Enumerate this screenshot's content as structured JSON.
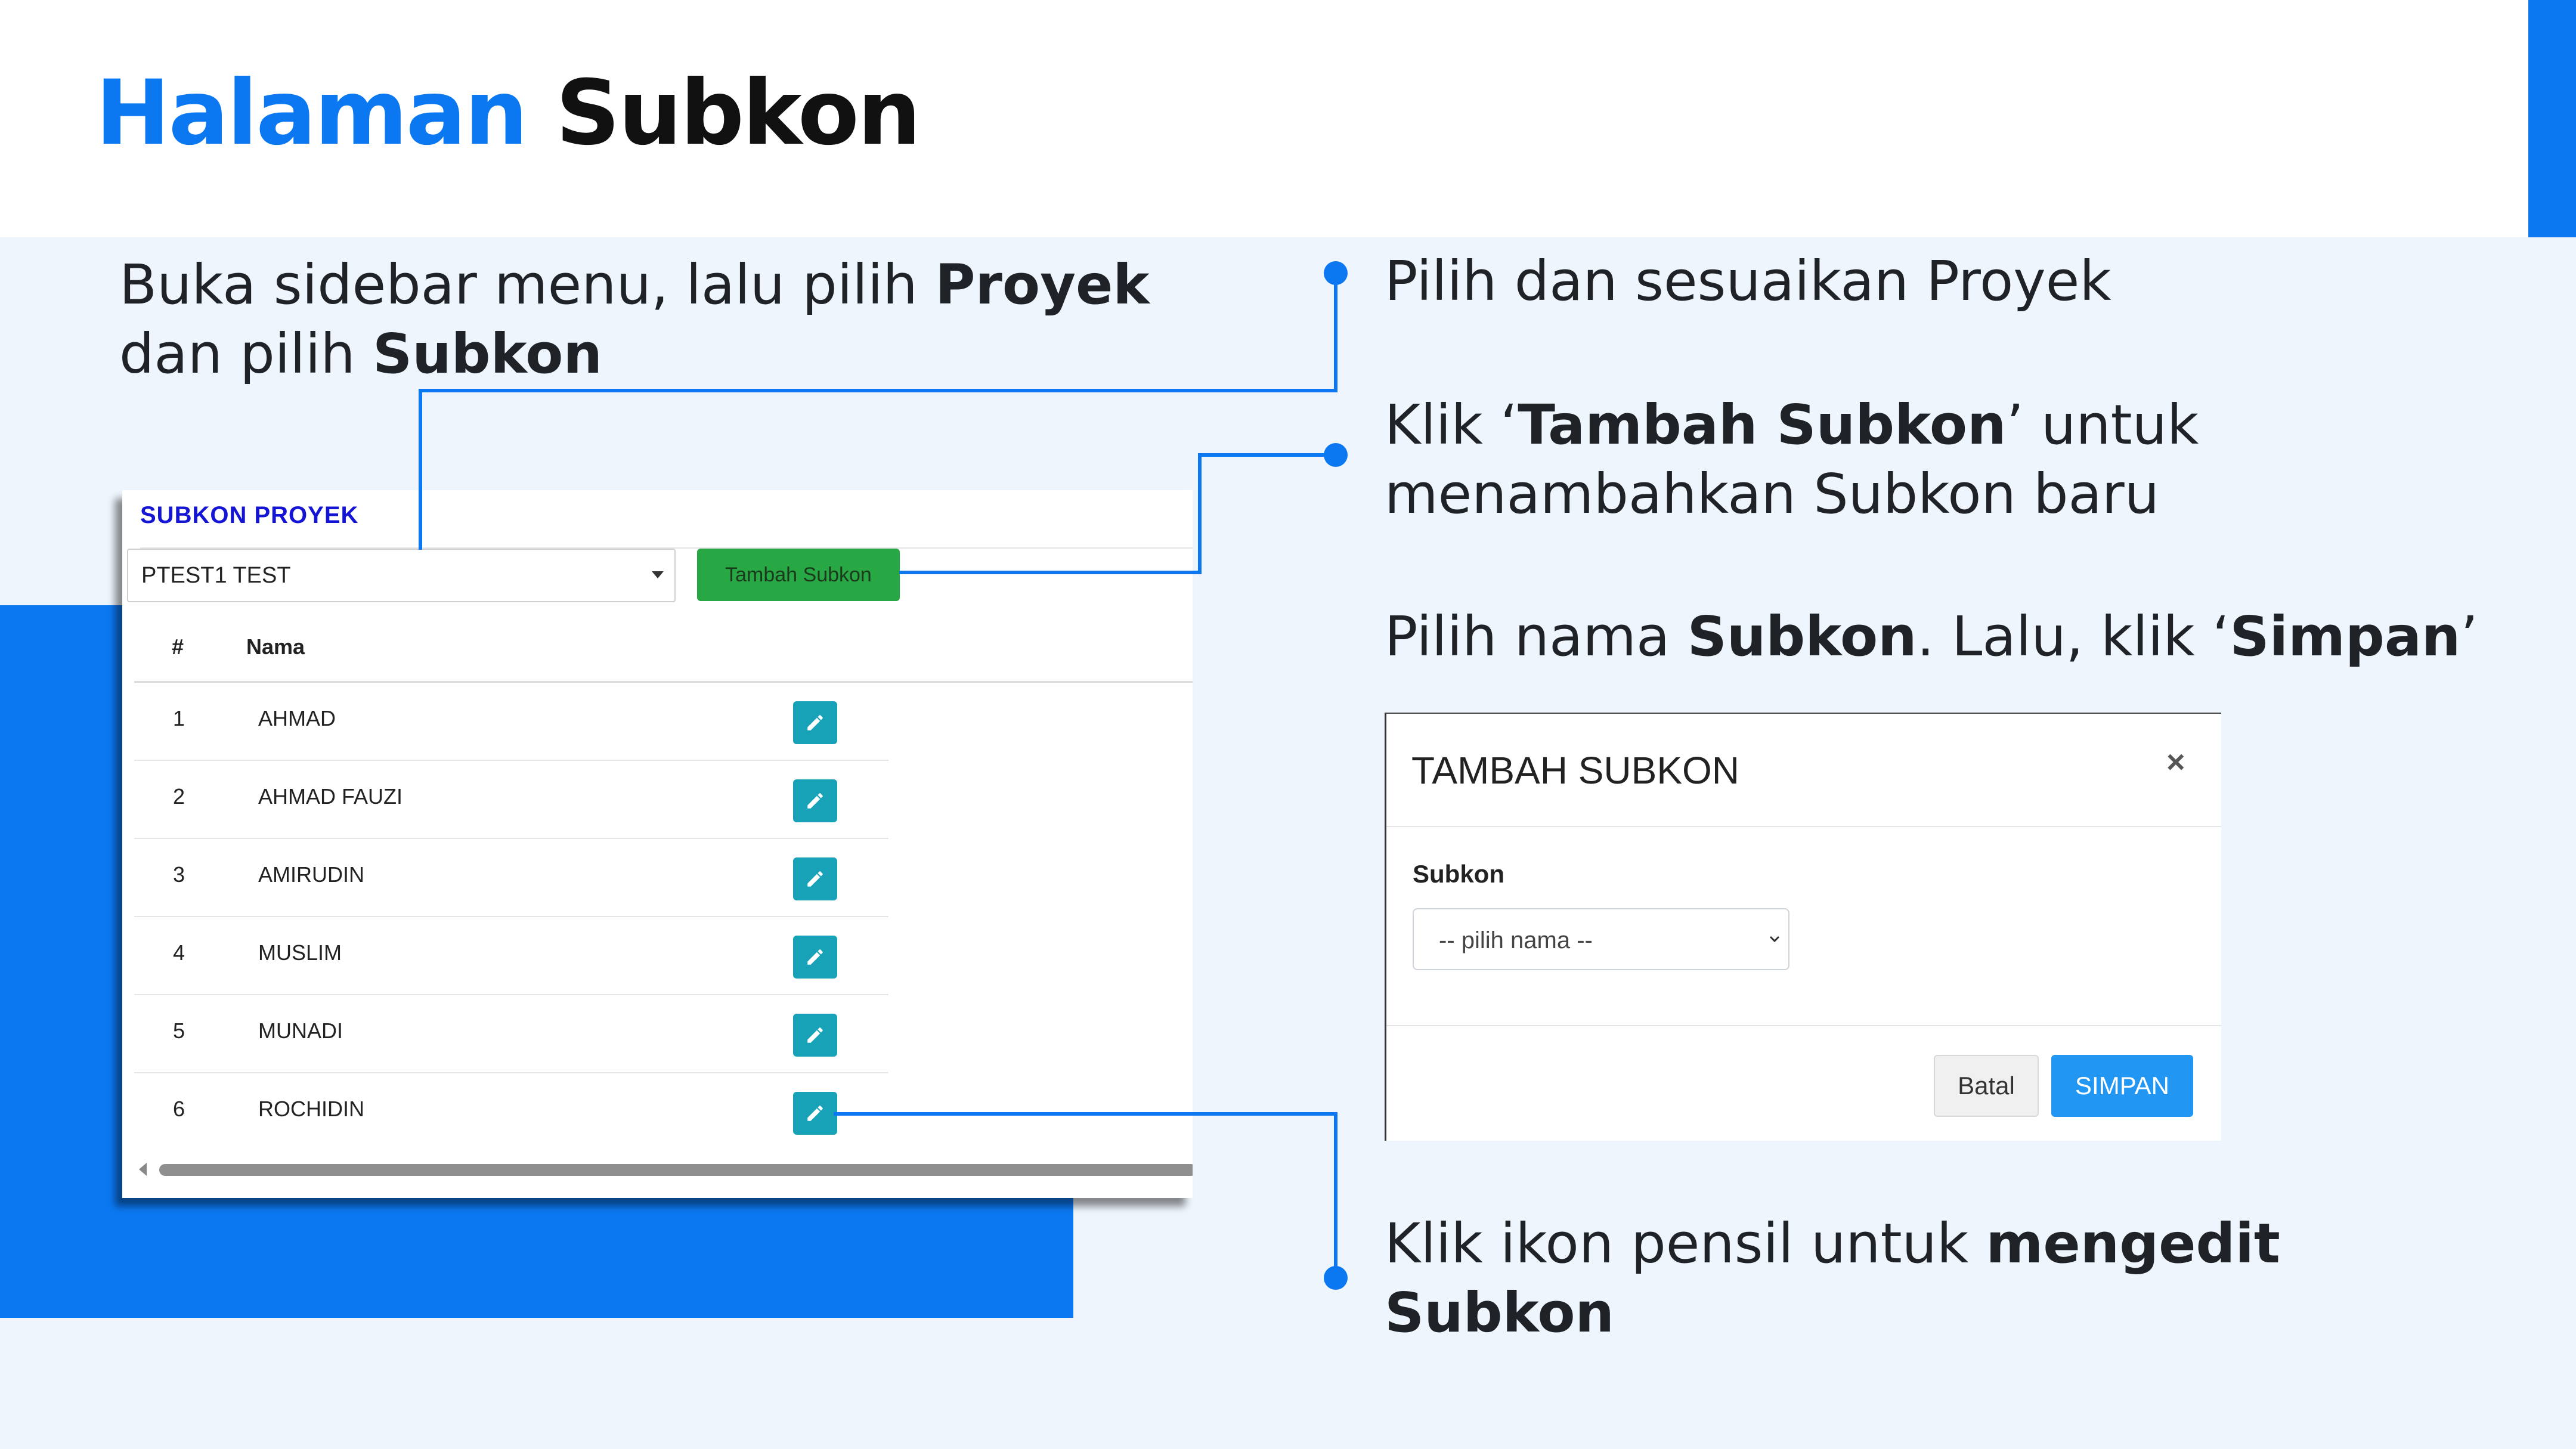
{
  "title": {
    "highlight": "Halaman",
    "rest": "Subkon"
  },
  "instructions": {
    "left": {
      "line1_pre": "Buka sidebar menu, lalu pilih ",
      "line1_bold": "Proyek",
      "line2_pre": "dan pilih ",
      "line2_bold": "Subkon"
    },
    "step1": {
      "text": "Pilih dan sesuaikan Proyek"
    },
    "step2": {
      "pre": "Klik ‘",
      "bold": "Tambah Subkon",
      "post": "’ untuk",
      "line2": "menambahkan Subkon baru"
    },
    "step3": {
      "pre": "Pilih nama ",
      "bold1": "Subkon",
      "mid": ". Lalu, klik ‘",
      "bold2": "Simpan",
      "post": "’"
    },
    "step4": {
      "pre": "Klik ikon pensil untuk ",
      "bold1": "mengedit",
      "bold2": "Subkon"
    }
  },
  "subkon_screen": {
    "header": "SUBKON PROYEK",
    "project_select": "PTEST1 TEST",
    "add_button": "Tambah Subkon",
    "columns": [
      "#",
      "Nama"
    ],
    "rows": [
      {
        "no": "1",
        "nama": "AHMAD"
      },
      {
        "no": "2",
        "nama": "AHMAD FAUZI"
      },
      {
        "no": "3",
        "nama": "AMIRUDIN"
      },
      {
        "no": "4",
        "nama": "MUSLIM"
      },
      {
        "no": "5",
        "nama": "MUNADI"
      },
      {
        "no": "6",
        "nama": "ROCHIDIN"
      }
    ],
    "row_action_icon": "pencil-icon"
  },
  "modal": {
    "title": "TAMBAH SUBKON",
    "close": "×",
    "field_label": "Subkon",
    "select_placeholder": "-- pilih nama --",
    "cancel": "Batal",
    "save": "SIMPAN"
  },
  "colors": {
    "accent": "#0b78f2",
    "panel_bg": "#eef5fd",
    "add_button": "#28a745",
    "edit_button": "#17a2b8",
    "save_button": "#2196f3"
  }
}
